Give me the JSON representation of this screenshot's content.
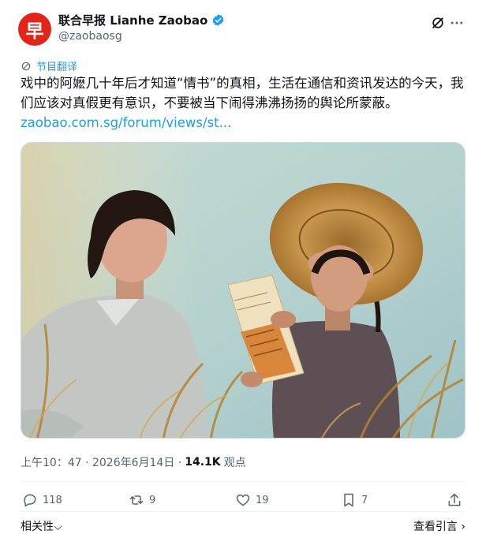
{
  "author": {
    "avatar_glyph": "早",
    "display_name": "联合早报 Lianhe Zaobao",
    "handle": "@zaobaosg",
    "brand_color": "#e1251b",
    "verified_color": "#1d9bf0"
  },
  "header": {
    "grok_icon": "slash-circle-icon",
    "more_icon": "more-icon"
  },
  "translation": {
    "label": "节目翻译"
  },
  "tweet": {
    "text": "戏中的阿嬷几十年后才知道“情书”的真相，生活在通信和资讯发达的今天，我们应该对真假更有意识，不要被当下闹得沸沸扬扬的舆论所蒙蔽。",
    "link_text": "zaobao.com.sg/forum/views/st..."
  },
  "meta": {
    "time": "上午10：47 · 2026年6月14日 · ",
    "views_count": "14.1K",
    "views_label": "观点"
  },
  "actions": {
    "replies": "118",
    "reposts": "9",
    "likes": "19",
    "bookmarks": "7"
  },
  "footer": {
    "left": "相关性⌵",
    "right": "查看引言 ›"
  },
  "colors": {
    "accent": "#1d9bf0",
    "muted": "#536471"
  }
}
